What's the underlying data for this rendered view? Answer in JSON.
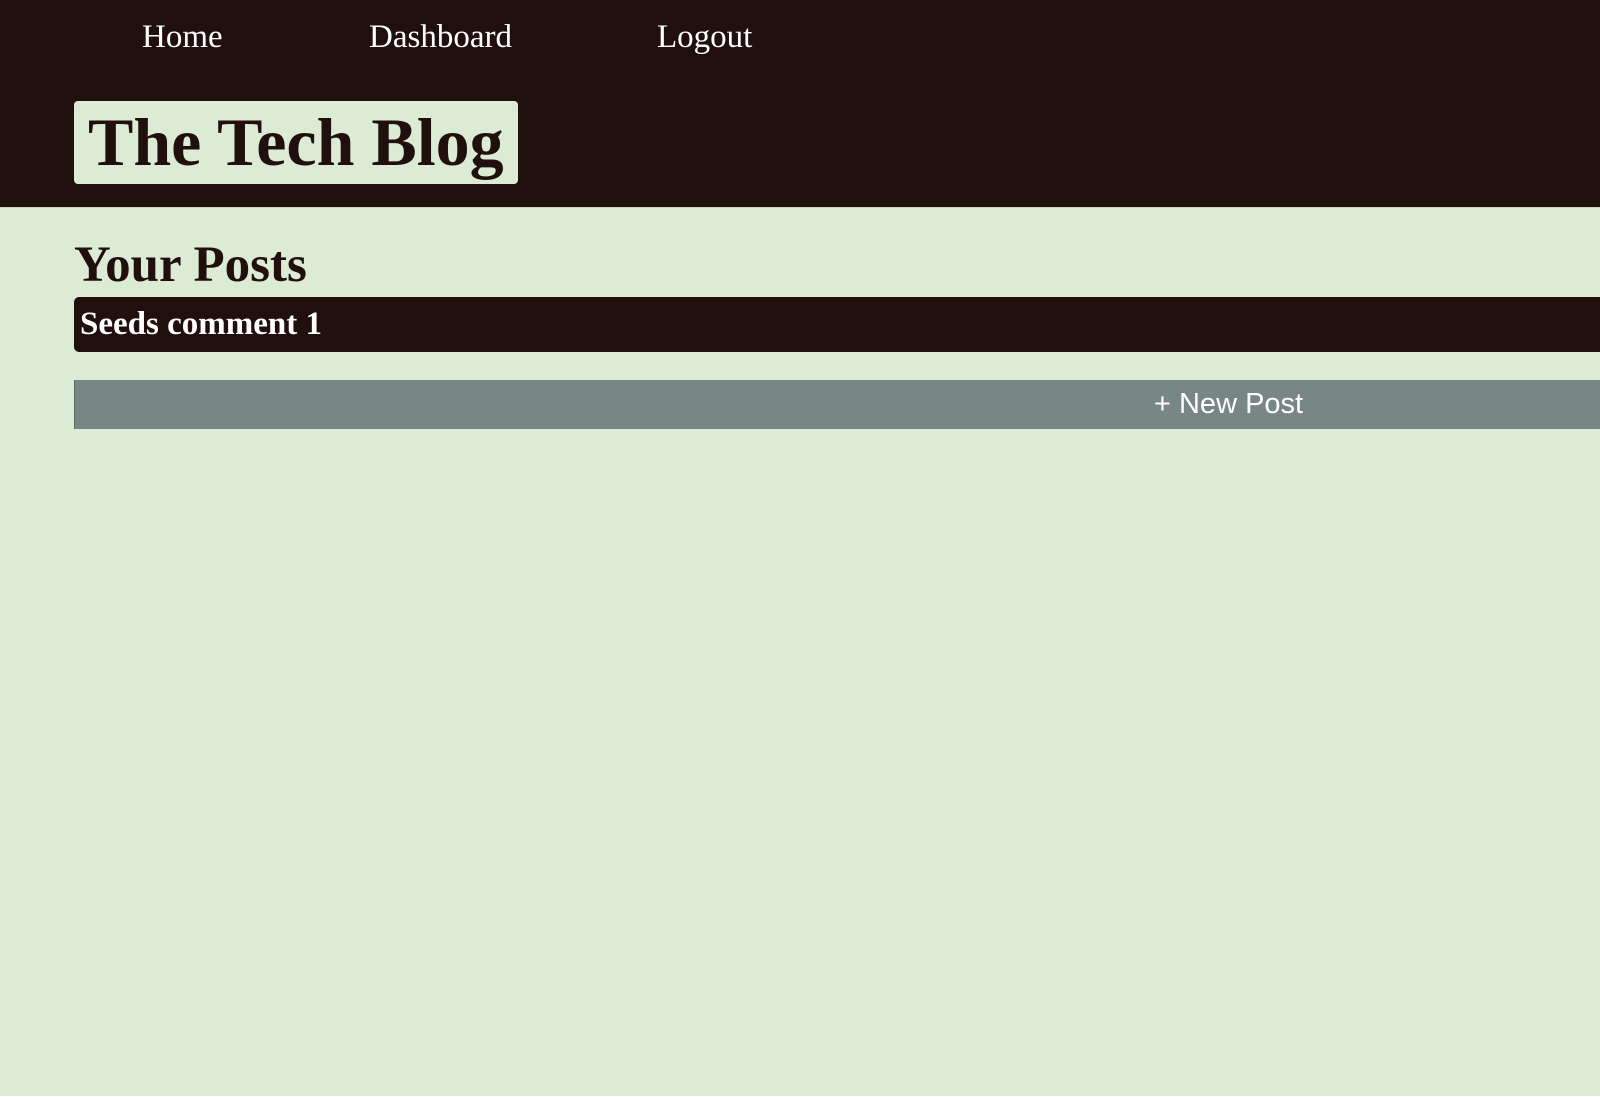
{
  "header": {
    "nav": {
      "home_label": "Home",
      "dashboard_label": "Dashboard",
      "logout_label": "Logout"
    },
    "brand_title": "The Tech Blog"
  },
  "main": {
    "section_title": "Your Posts",
    "posts": [
      {
        "title": "Seeds comment 1"
      }
    ],
    "new_post_label": "+ New Post"
  },
  "colors": {
    "header_bg": "#210f0e",
    "page_bg": "#dcebd4",
    "button_bg": "#788786",
    "text_light": "#ffffff",
    "text_dark": "#210f0e"
  }
}
